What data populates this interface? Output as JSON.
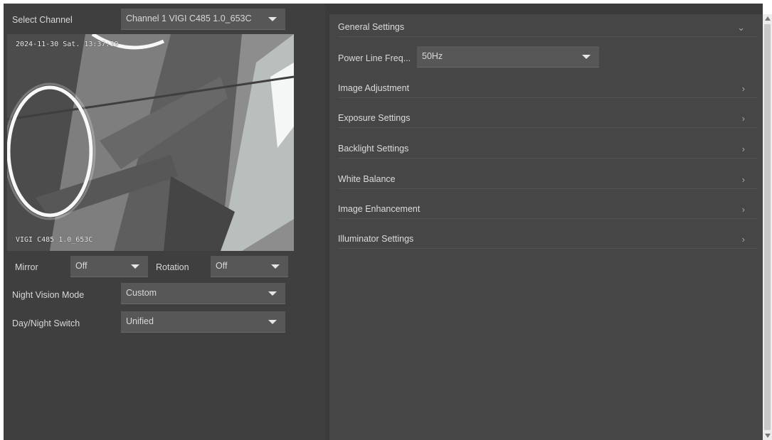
{
  "left": {
    "select_channel_label": "Select Channel",
    "channel_value": "Channel 1 VIGI C485 1.0_653C",
    "video": {
      "timestamp": "2024-11-30 Sat. 13:37:39",
      "camera_name": "VIGI C485 1.0_653C"
    },
    "mirror_label": "Mirror",
    "mirror_value": "Off",
    "rotation_label": "Rotation",
    "rotation_value": "Off",
    "night_vision_label": "Night Vision Mode",
    "night_vision_value": "Custom",
    "day_night_label": "Day/Night Switch",
    "day_night_value": "Unified"
  },
  "right": {
    "general_settings": "General Settings",
    "power_line_label": "Power Line Freq...",
    "power_line_value": "50Hz",
    "sections": [
      "Image Adjustment",
      "Exposure Settings",
      "Backlight Settings",
      "White Balance",
      "Image Enhancement",
      "Illuminator Settings"
    ]
  },
  "icons": {
    "expanded": "chevron-down-icon",
    "collapsed": "chevron-right-icon",
    "dropdown": "caret-down-icon"
  }
}
